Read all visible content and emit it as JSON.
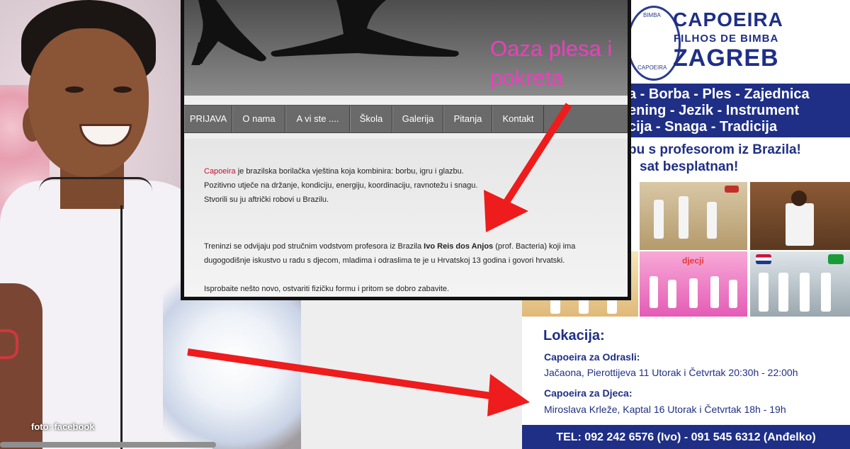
{
  "photo": {
    "caption": "foto: facebook"
  },
  "window": {
    "tagline_line1": "Oaza plesa i",
    "tagline_line2": "pokreta",
    "nav": [
      "PRIJAVA",
      "O nama",
      "A vi ste ....",
      "Škola",
      "Galerija",
      "Pitanja",
      "Kontakt"
    ],
    "content": {
      "p1_link": "Capoeira",
      "p1_rest": " je brazilska borilačka vještina koja kombinira: borbu, igru i glazbu.",
      "p2": "Pozitivno utječe na držanje, kondiciju, energiju, koordinaciju, ravnotežu i snagu.",
      "p3": "Stvorili su ju aftrički robovi u Brazilu.",
      "p4_pre": "Treninzi se odvijaju pod stručnim vodstvom profesora iz Brazila ",
      "p4_bold": "Ivo Reis dos Anjos",
      "p4_post": " (prof. Bacteria) koji ima",
      "p5": "dugogodišnje iskustvo u radu s djecom, mladima i odraslima te je u Hrvatskoj 13 godina i govori hrvatski.",
      "p6": "Isprobaite nešto novo, ostvariti fizičku formu i pritom se dobro zabavite."
    }
  },
  "poster": {
    "emblem_top": "BIMBA",
    "emblem_bottom": "CAPOEIRA",
    "title1": "CAPOEIRA",
    "title2": "FILHOS DE BIMBA",
    "title3": "ZAGREB",
    "band": [
      "a  -  Borba  -  Ples  -  Zajednica",
      "ening  -  Jezik  -  Instrument",
      "cija  -  Snaga  -  Tradicija"
    ],
    "promo1": "bu s profesorom iz Brazila!",
    "promo2": "sat besplatnan!",
    "gallery_label": "djecji",
    "lokacija": "Lokacija:",
    "odrasli_head": "Capoeira za Odrasli:",
    "odrasli_text": "Jačaona, Pierottijeva 11 Utorak i Četvrtak 20:30h - 22:00h",
    "djeca_head": "Capoeira za Djeca:",
    "djeca_text": "Miroslava Krleže, Kaptal 16  Utorak i Četvrtak 18h - 19h",
    "tel": "TEL: 092 242 6576 (Ivo) - 091 545 6312 (Anđelko)"
  },
  "colors": {
    "accent": "#ec3fbe",
    "poster_blue": "#1f2f86",
    "arrow_red": "#ee1c1c"
  }
}
